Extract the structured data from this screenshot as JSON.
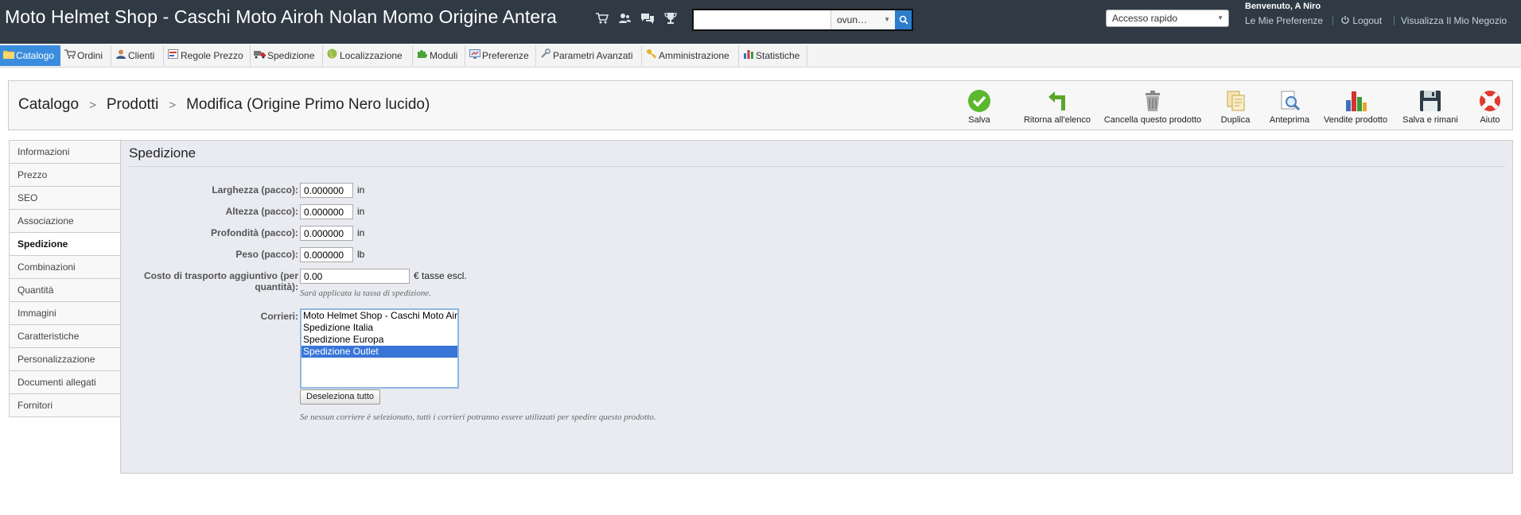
{
  "header": {
    "shop_title": "Moto Helmet Shop - Caschi Moto Airoh Nolan Momo Origine Antera",
    "icons": [
      "cart-icon",
      "customers-icon",
      "messages-icon",
      "trophy-icon"
    ],
    "search": {
      "value": "",
      "scope": "ovun…"
    },
    "quick_access": "Accesso rapido",
    "welcome": "Benvenuto, A Niro",
    "links": {
      "preferences": "Le Mie Preferenze",
      "logout": "Logout",
      "view_shop": "Visualizza Il Mio Negozio"
    }
  },
  "menu": {
    "items": [
      {
        "label": "Catalogo",
        "icon": "folder-icon"
      },
      {
        "label": "Ordini",
        "icon": "cart-icon"
      },
      {
        "label": "Clienti",
        "icon": "user-icon"
      },
      {
        "label": "Regole Prezzo",
        "icon": "price-rule-icon"
      },
      {
        "label": "Spedizione",
        "icon": "truck-icon"
      },
      {
        "label": "Localizzazione",
        "icon": "globe-icon"
      },
      {
        "label": "Moduli",
        "icon": "puzzle-icon"
      },
      {
        "label": "Preferenze",
        "icon": "preferences-icon"
      },
      {
        "label": "Parametri Avanzati",
        "icon": "wrench-icon"
      },
      {
        "label": "Amministrazione",
        "icon": "key-icon"
      },
      {
        "label": "Statistiche",
        "icon": "bar-chart-icon"
      }
    ],
    "active": "Catalogo"
  },
  "breadcrumb": {
    "level1": "Catalogo",
    "level2": "Prodotti",
    "level3": "Modifica (Origine Primo Nero lucido)"
  },
  "toolbar": {
    "buttons": [
      {
        "label": "Salva",
        "icon": "check-icon"
      },
      {
        "label": "Ritorna all'elenco",
        "icon": "back-arrow-icon"
      },
      {
        "label": "Cancella questo prodotto",
        "icon": "trash-icon"
      },
      {
        "label": "Duplica",
        "icon": "duplicate-icon"
      },
      {
        "label": "Anteprima",
        "icon": "preview-icon"
      },
      {
        "label": "Vendite prodotto",
        "icon": "sales-chart-icon"
      },
      {
        "label": "Salva e rimani",
        "icon": "floppy-icon"
      },
      {
        "label": "Aiuto",
        "icon": "lifebuoy-icon"
      }
    ]
  },
  "tabs": [
    "Informazioni",
    "Prezzo",
    "SEO",
    "Associazione",
    "Spedizione",
    "Combinazioni",
    "Quantità",
    "Immagini",
    "Caratteristiche",
    "Personalizzazione",
    "Documenti allegati",
    "Fornitori"
  ],
  "active_tab": "Spedizione",
  "shipping": {
    "title": "Spedizione",
    "fields": [
      {
        "label": "Larghezza (pacco):",
        "value": "0.000000",
        "unit": "in"
      },
      {
        "label": "Altezza (pacco):",
        "value": "0.000000",
        "unit": "in"
      },
      {
        "label": "Profondità (pacco):",
        "value": "0.000000",
        "unit": "in"
      },
      {
        "label": "Peso (pacco):",
        "value": "0.000000",
        "unit": "lb"
      }
    ],
    "extra_cost": {
      "label": "Costo di trasporto aggiuntivo (per quantità):",
      "value": "0.00",
      "unit": "€ tasse escl.",
      "hint": "Sarà applicata la tassa di spedizione."
    },
    "carriers": {
      "label": "Corrieri:",
      "options": [
        "Moto Helmet Shop - Caschi Moto Airoh Nolan Momo Origine Antera",
        "Spedizione Italia",
        "Spedizione Europa",
        "Spedizione Outlet"
      ],
      "selected": "Spedizione Outlet",
      "deselect_label": "Deseleziona tutto",
      "hint": "Se nessun corriere è selezionato, tutti i corrieri potranno essere utilizzati per spedire questo prodotto."
    }
  }
}
